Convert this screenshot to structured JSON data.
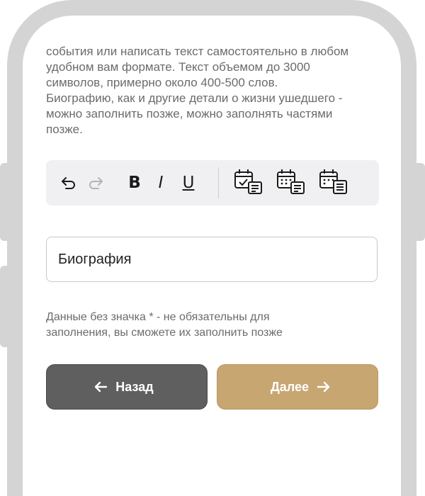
{
  "description": {
    "lines": [
      "события или написать текст самостоятельно в любом",
      "удобном вам формате. Текст объемом до 3000",
      "символов, примерно около 400-500 слов.",
      "Биографию, как и другие детали о жизни ушедшего -",
      "можно заполнить позже, можно заполнять частями",
      "позже."
    ]
  },
  "toolbar": {
    "bold_label": "B",
    "italic_label": "I",
    "underline_label": "U",
    "icons": [
      "undo-icon",
      "redo-icon",
      "calendar-check-list-icon",
      "calendar-list-icon",
      "calendar-notes-icon"
    ]
  },
  "field": {
    "value": "Биография"
  },
  "note": {
    "lines": [
      "Данные без значка * - не обязательны для",
      "заполнения, вы сможете их заполнить позже"
    ]
  },
  "buttons": {
    "back_label": "Назад",
    "next_label": "Далее"
  },
  "colors": {
    "back_button": "#5f5f5f",
    "next_button": "#c8a672",
    "frame": "#d4d4d4"
  }
}
